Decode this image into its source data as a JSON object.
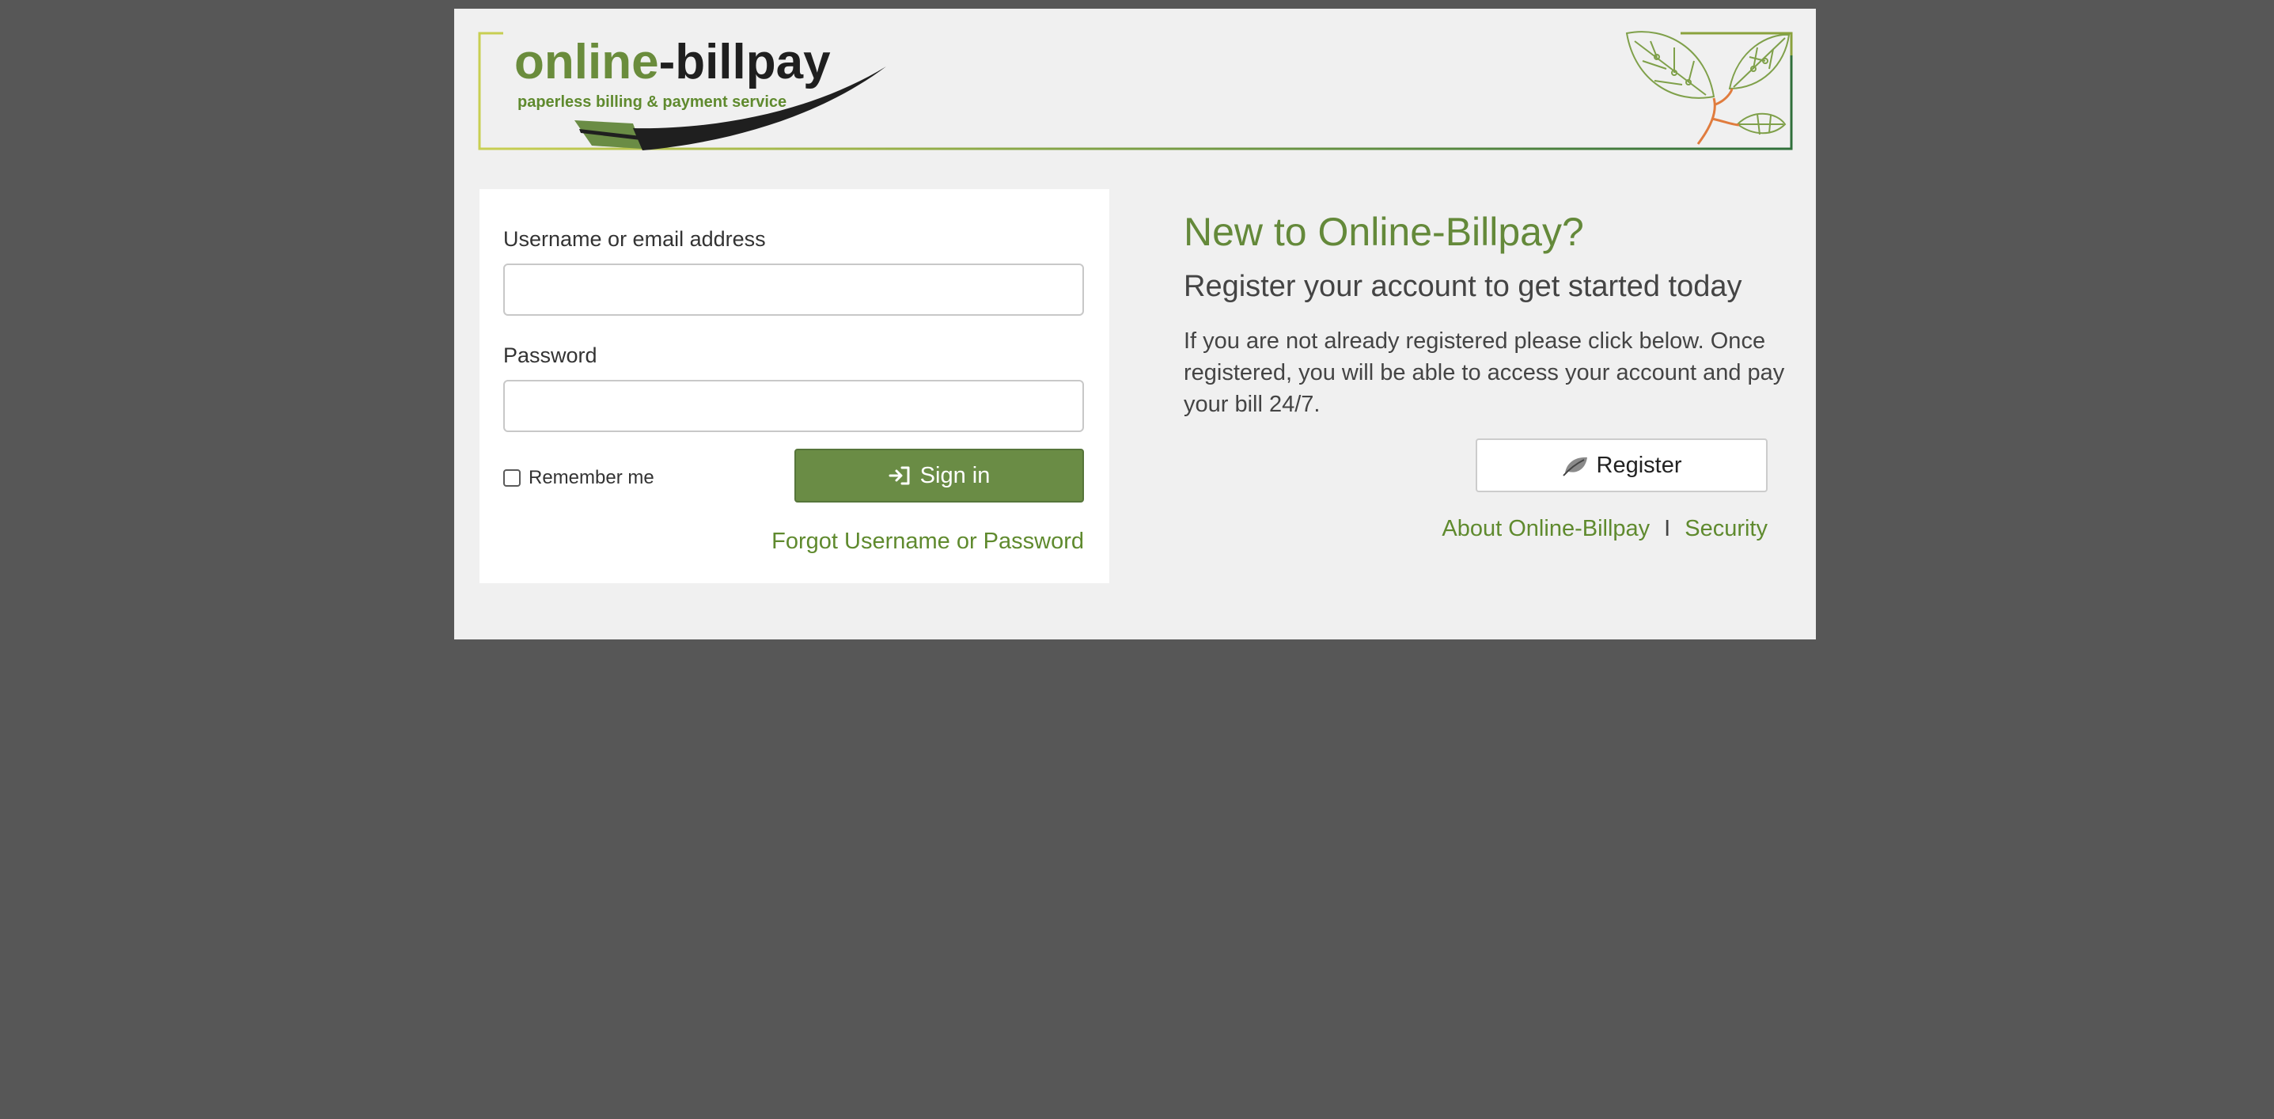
{
  "banner": {
    "logo_part1": "online",
    "logo_part2": "-billpay",
    "tagline": "paperless billing & payment service"
  },
  "login": {
    "username_label": "Username or email address",
    "username_value": "",
    "password_label": "Password",
    "password_value": "",
    "remember_label": "Remember me",
    "remember_checked": false,
    "signin_label": "Sign in",
    "forgot_label": "Forgot Username or Password"
  },
  "register": {
    "title": "New to Online-Billpay?",
    "subtitle": "Register your account to get started today",
    "body": "If you are not already registered please click below. Once registered, you will be able to access your account and pay your bill 24/7.",
    "button_label": "Register",
    "about_link": "About Online-Billpay",
    "separator": "I",
    "security_link": "Security"
  },
  "colors": {
    "brand_green": "#6a8c45",
    "link_green": "#5f8a2e",
    "backdrop": "#575757",
    "panel": "#f0f0f0"
  },
  "icons": {
    "signin": "sign-in-arrow-icon",
    "register": "leaf-icon"
  }
}
